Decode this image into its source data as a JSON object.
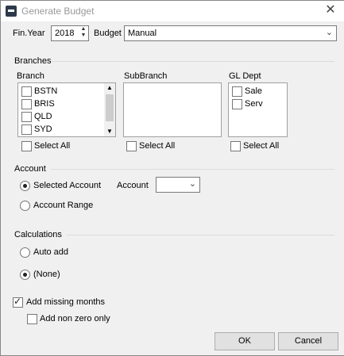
{
  "window": {
    "title": "Generate Budget",
    "close": "✕"
  },
  "top": {
    "fin_year_label": "Fin.Year",
    "fin_year_value": "2018",
    "budget_label": "Budget",
    "budget_value": "Manual"
  },
  "branches": {
    "section_label": "Branches",
    "branch": {
      "header": "Branch",
      "items": [
        "BSTN",
        "BRIS",
        "QLD",
        "SYD"
      ],
      "select_all": "Select All"
    },
    "subbranch": {
      "header": "SubBranch",
      "select_all": "Select All"
    },
    "gldept": {
      "header": "GL Dept",
      "items": [
        "Sale",
        "Serv"
      ],
      "select_all": "Select All"
    }
  },
  "account": {
    "section_label": "Account",
    "selected_label": "Selected Account",
    "account_label": "Account",
    "range_label": "Account Range",
    "selected": "selected"
  },
  "calculations": {
    "section_label": "Calculations",
    "auto_add_label": "Auto add",
    "none_label": "(None)",
    "selected": "none"
  },
  "options": {
    "add_missing_months": "Add missing months",
    "add_missing_months_checked": true,
    "add_non_zero_only": "Add non zero only",
    "add_non_zero_only_checked": false
  },
  "buttons": {
    "ok": "OK",
    "cancel": "Cancel"
  }
}
